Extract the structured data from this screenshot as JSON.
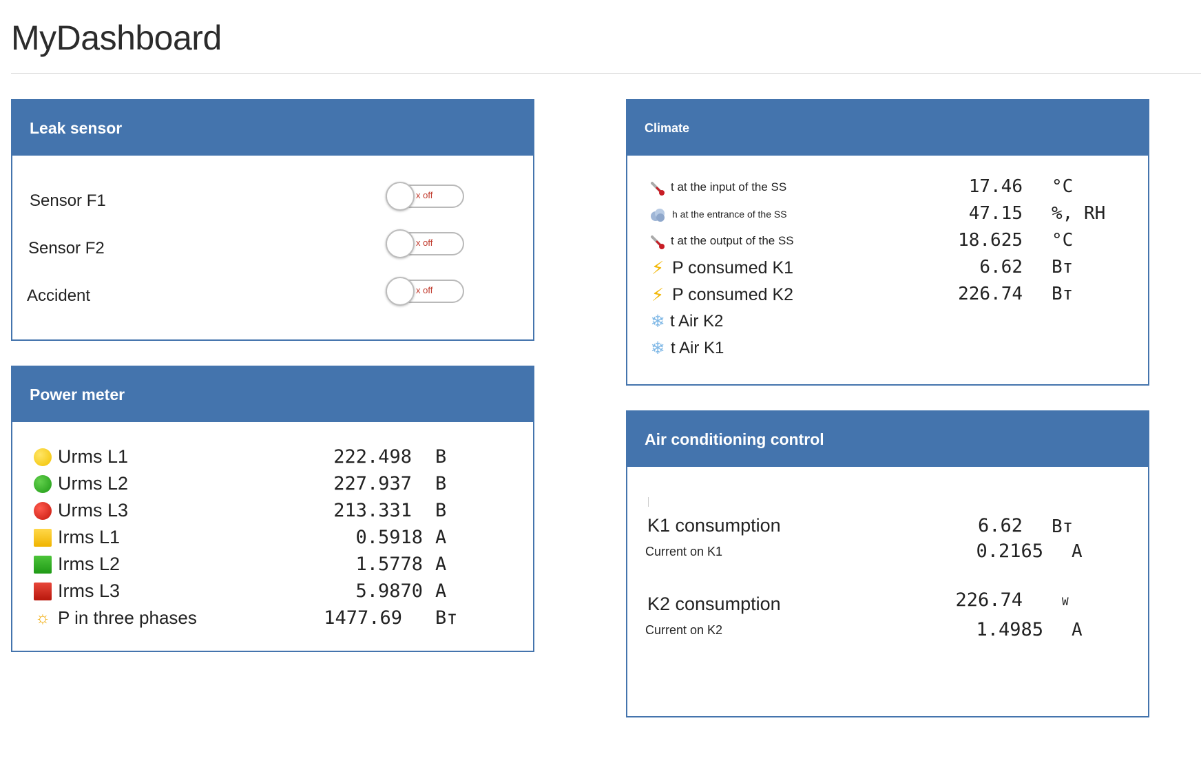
{
  "page": {
    "title": "MyDashboard"
  },
  "colors": {
    "panel_header": "#4474ad",
    "toggle_off_text": "#c0392b"
  },
  "leak_sensor": {
    "title": "Leak sensor",
    "rows": [
      {
        "label": "Sensor F1",
        "state": "x off"
      },
      {
        "label": "Sensor F2",
        "state": "x off"
      },
      {
        "label": "Accident",
        "state": "x off"
      }
    ]
  },
  "power_meter": {
    "title": "Power meter",
    "rows": [
      {
        "icon": "yellow-circle-icon",
        "label": "Urms L1",
        "value": "222.498",
        "unit": "B"
      },
      {
        "icon": "green-circle-icon",
        "label": "Urms L2",
        "value": "227.937",
        "unit": "B"
      },
      {
        "icon": "red-circle-icon",
        "label": "Urms L3",
        "value": "213.331",
        "unit": "B"
      },
      {
        "icon": "yellow-square-icon",
        "label": "Irms L1",
        "value": "0.5918",
        "unit": "A"
      },
      {
        "icon": "green-square-icon",
        "label": "Irms L2",
        "value": "1.5778",
        "unit": "A"
      },
      {
        "icon": "red-square-icon",
        "label": "Irms L3",
        "value": "5.9870",
        "unit": "A"
      },
      {
        "icon": "sun-icon",
        "label": "P in three phases",
        "value": "1477.69",
        "unit": "Вт"
      }
    ]
  },
  "climate": {
    "title": "Climate",
    "rows": [
      {
        "icon": "thermometer-icon",
        "label": "t at the input of the SS",
        "value": "17.46",
        "unit": "°C"
      },
      {
        "icon": "cloud-icon",
        "label": "h at the entrance of the SS",
        "value": "47.15",
        "unit": "%, RH"
      },
      {
        "icon": "thermometer-icon",
        "label": "t at the output of the SS",
        "value": "18.625",
        "unit": "°C"
      },
      {
        "icon": "lightning-icon",
        "label": "P consumed K1",
        "value": "6.62",
        "unit": "Вт"
      },
      {
        "icon": "lightning-icon",
        "label": "P consumed K2",
        "value": "226.74",
        "unit": "Вт"
      },
      {
        "icon": "snowflake-icon",
        "label": "t Air K2",
        "value": "",
        "unit": ""
      },
      {
        "icon": "snowflake-icon",
        "label": "t Air K1",
        "value": "",
        "unit": ""
      }
    ]
  },
  "ac_control": {
    "title": "Air conditioning control",
    "k1": {
      "title": "K1 consumption",
      "value": "6.62",
      "unit": "Вт",
      "sub_label": "Current on K1",
      "sub_value": "0.2165",
      "sub_unit": "A"
    },
    "k2": {
      "title": "K2 consumption",
      "value": "226.74",
      "unit": "W",
      "sub_label": "Current on K2",
      "sub_value": "1.4985",
      "sub_unit": "A"
    }
  }
}
